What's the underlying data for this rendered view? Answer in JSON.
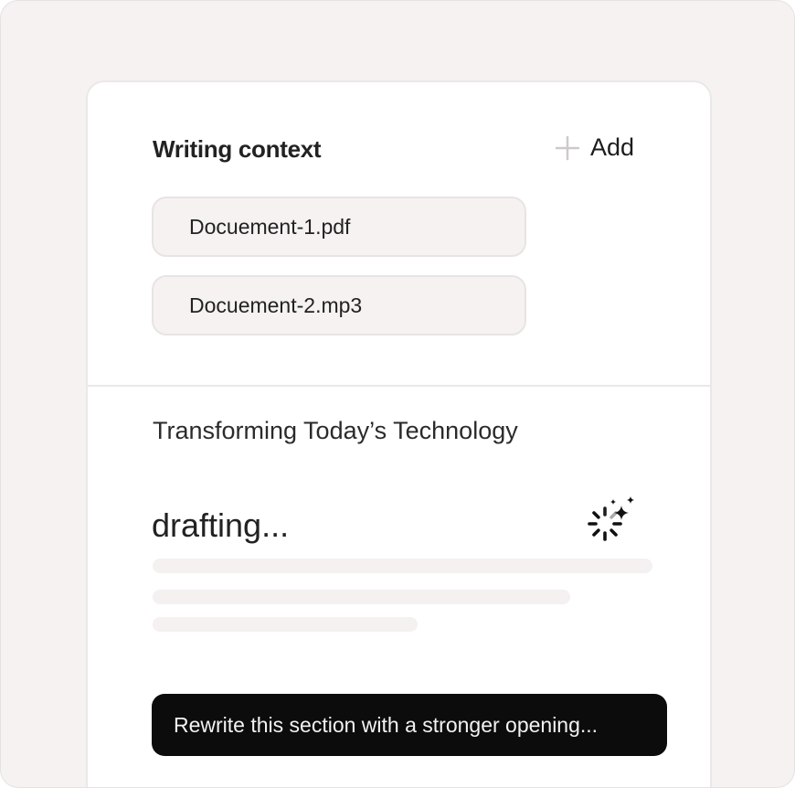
{
  "context": {
    "title": "Writing context",
    "add_label": "Add",
    "files": [
      {
        "name": "Docuement-1.pdf"
      },
      {
        "name": "Docuement-2.mp3"
      }
    ]
  },
  "draft": {
    "section_title": "Transforming Today’s Technology",
    "status": "drafting..."
  },
  "prompt": {
    "text": "Rewrite this section with a stronger opening..."
  },
  "colors": {
    "background": "#f5f2f1",
    "panel": "#ffffff",
    "prompt_bg": "#0c0c0c",
    "skeleton": "#f4f1f0"
  },
  "icons": [
    "plus-icon",
    "sparkle-spinner-icon"
  ]
}
